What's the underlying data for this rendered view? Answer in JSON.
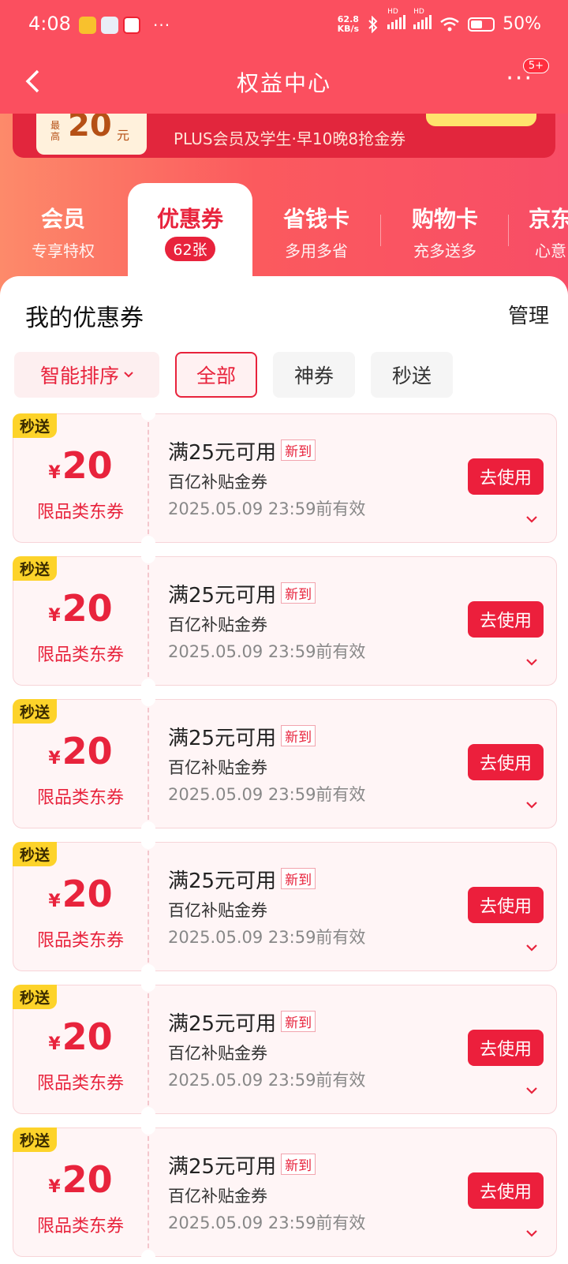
{
  "status_bar": {
    "time": "4:08",
    "more": "···",
    "net_speed_value": "62.8",
    "net_speed_unit": "KB/s",
    "battery": "50%",
    "hd1": "HD",
    "hd2": "HD",
    "wifi_label": "6"
  },
  "nav": {
    "back": "‹",
    "title": "权益中心",
    "more": "···",
    "badge": "5+"
  },
  "banner": {
    "max_label": "最高",
    "amount": "20",
    "unit": "元",
    "subtitle": "PLUS会员及学生·早10晚8抢金券"
  },
  "tabs": [
    {
      "title": "会员",
      "subtitle": "专享特权"
    },
    {
      "title": "优惠券",
      "count": "62张"
    },
    {
      "title": "省钱卡",
      "subtitle": "多用多省"
    },
    {
      "title": "购物卡",
      "subtitle": "充多送多"
    },
    {
      "title": "京东",
      "subtitle": "心意"
    }
  ],
  "section": {
    "title": "我的优惠券",
    "manage": "管理"
  },
  "filters": {
    "sort": "智能排序",
    "all": "全部",
    "god": "神券",
    "instant": "秒送"
  },
  "coupons": [
    {
      "tag": "秒送",
      "currency": "¥",
      "amount": "20",
      "scope": "限品类东券",
      "condition": "满25元可用",
      "new_tag": "新到",
      "type": "百亿补贴金券",
      "expiry": "2025.05.09 23:59前有效",
      "action": "去使用"
    },
    {
      "tag": "秒送",
      "currency": "¥",
      "amount": "20",
      "scope": "限品类东券",
      "condition": "满25元可用",
      "new_tag": "新到",
      "type": "百亿补贴金券",
      "expiry": "2025.05.09 23:59前有效",
      "action": "去使用"
    },
    {
      "tag": "秒送",
      "currency": "¥",
      "amount": "20",
      "scope": "限品类东券",
      "condition": "满25元可用",
      "new_tag": "新到",
      "type": "百亿补贴金券",
      "expiry": "2025.05.09 23:59前有效",
      "action": "去使用"
    },
    {
      "tag": "秒送",
      "currency": "¥",
      "amount": "20",
      "scope": "限品类东券",
      "condition": "满25元可用",
      "new_tag": "新到",
      "type": "百亿补贴金券",
      "expiry": "2025.05.09 23:59前有效",
      "action": "去使用"
    },
    {
      "tag": "秒送",
      "currency": "¥",
      "amount": "20",
      "scope": "限品类东券",
      "condition": "满25元可用",
      "new_tag": "新到",
      "type": "百亿补贴金券",
      "expiry": "2025.05.09 23:59前有效",
      "action": "去使用"
    },
    {
      "tag": "秒送",
      "currency": "¥",
      "amount": "20",
      "scope": "限品类东券",
      "condition": "满25元可用",
      "new_tag": "新到",
      "type": "百亿补贴金券",
      "expiry": "2025.05.09 23:59前有效",
      "action": "去使用"
    }
  ]
}
